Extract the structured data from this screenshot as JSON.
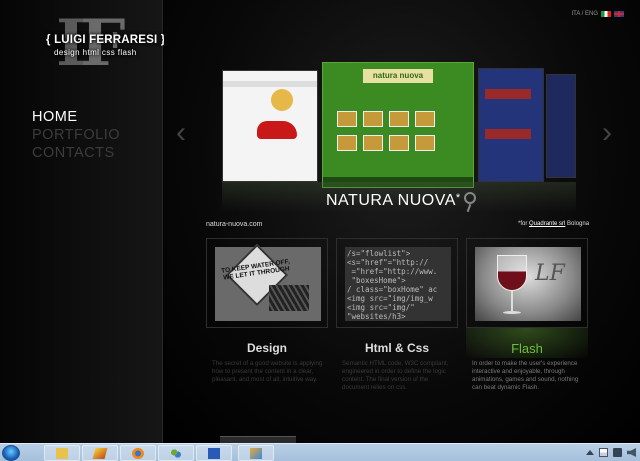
{
  "logo": {
    "monogram_a": "L",
    "monogram_b": "F",
    "name": "{ LUIGI FERRARESI }",
    "tagline": "design html css flash"
  },
  "nav": {
    "items": [
      {
        "label": "HOME",
        "active": true
      },
      {
        "label": "PORTFOLIO",
        "active": false
      },
      {
        "label": "CONTACTS",
        "active": false
      }
    ]
  },
  "language": {
    "label": "ITA / ENG",
    "options": [
      "ITA",
      "ENG"
    ]
  },
  "showcase": {
    "featured_title": "NATURA NUOVA",
    "featured_mark": "*",
    "site_url": "natura-nuova.com",
    "credit_prefix": "*for",
    "credit_link": "Quadrante srl",
    "credit_suffix": "Bologna",
    "center_panel_title": "natura nuova"
  },
  "cards": [
    {
      "title": "Design",
      "image_text": "TO KEEP WATER OFF, WE LET IT THROUGH",
      "description": "The secret of a good website is applying how to present the content in a clear, pleasant, and most of all, intuitive way."
    },
    {
      "title": "Html & Css",
      "image_code": "/s=\"flowlist\">\n<s=\"href\"=\"http://\n =\"href=\"http://www.\n \"boxesHome\">\n/ class=\"boxHome\" ac\n<img src=\"img/img_w\n<img src=\"img/\"\n\"websites/h3>",
      "description": "Semantic HTML code, W3C compliant, engineered in order to define the logic content. The final version of the document relies on css."
    },
    {
      "title": "Flash",
      "image_monogram": "LF",
      "description": "In order to make the user's experience interactive and enjoyable, through animations, games and sound, nothing can beat dynamic Flash."
    }
  ],
  "taskbar": {
    "apps": [
      "folder-icon",
      "flash-icon",
      "firefox-icon",
      "people-icon",
      "word-icon",
      "paint-icon"
    ]
  },
  "colors": {
    "background": "#000000",
    "flash_green": "#6fbf3a",
    "taskbar": "#b8cfe6"
  }
}
